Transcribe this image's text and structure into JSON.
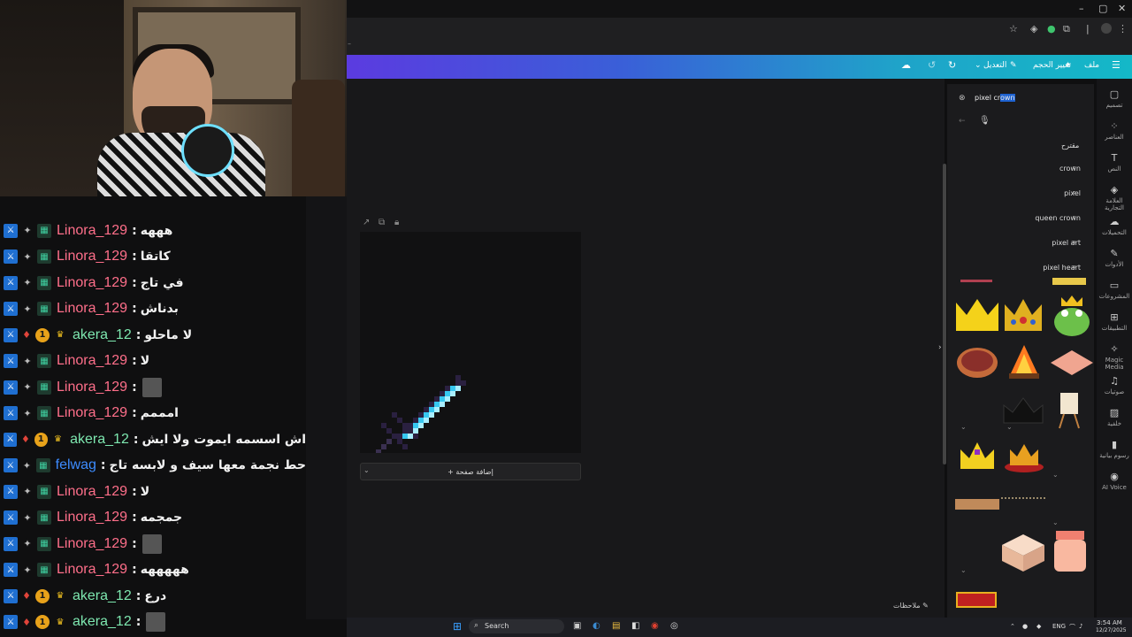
{
  "chat": {
    "messages": [
      {
        "user": "Linora_129",
        "role": "linora",
        "text": "هههه"
      },
      {
        "user": "Linora_129",
        "role": "linora",
        "text": "كاتقا"
      },
      {
        "user": "Linora_129",
        "role": "linora",
        "text": "في تاج"
      },
      {
        "user": "Linora_129",
        "role": "linora",
        "text": "بدناش"
      },
      {
        "user": "akera_12",
        "role": "akera",
        "text": "لا ماحلو"
      },
      {
        "user": "Linora_129",
        "role": "linora",
        "text": "لا"
      },
      {
        "user": "Linora_129",
        "role": "linora",
        "text": ""
      },
      {
        "user": "Linora_129",
        "role": "linora",
        "text": "امممم"
      },
      {
        "user": "akera_12",
        "role": "akera",
        "text": "اش اسسمه ايموت ولا ايش"
      },
      {
        "user": "felwag",
        "role": "felwag",
        "text": "حط نجمة معها سيف و لابسه تاج"
      },
      {
        "user": "Linora_129",
        "role": "linora",
        "text": "لا"
      },
      {
        "user": "Linora_129",
        "role": "linora",
        "text": "جمجمه"
      },
      {
        "user": "Linora_129",
        "role": "linora",
        "text": ""
      },
      {
        "user": "Linora_129",
        "role": "linora",
        "text": "هههههه"
      },
      {
        "user": "akera_12",
        "role": "akera",
        "text": "درع"
      },
      {
        "user": "akera_12",
        "role": "akera",
        "text": ""
      }
    ],
    "separator": ":"
  },
  "toolbar": {
    "file": "ملف",
    "resize": "تغيير الحجم",
    "edit": "التعديل"
  },
  "canvas": {
    "add_page": "+ إضافة صفحة",
    "notes": "ملاحظات"
  },
  "search": {
    "value_prefix": "pixel cr",
    "value_selected": "own",
    "suggested_heading": "مقترح",
    "suggestions": [
      "crown",
      "pixel",
      "queen crown",
      "pixel art",
      "pixel heart"
    ]
  },
  "rail": [
    {
      "icon": "layout-icon",
      "label": "تصميم"
    },
    {
      "icon": "elements-icon",
      "label": "العناصر"
    },
    {
      "icon": "text-icon",
      "label": "النص"
    },
    {
      "icon": "brand-icon",
      "label": "العلامة التجارية"
    },
    {
      "icon": "uploads-icon",
      "label": "التحميلات"
    },
    {
      "icon": "draw-icon",
      "label": "الأدوات"
    },
    {
      "icon": "projects-icon",
      "label": "المشروعات"
    },
    {
      "icon": "apps-icon",
      "label": "التطبيقات"
    },
    {
      "icon": "magic-media-icon",
      "label": "Magic Media"
    },
    {
      "icon": "audio-icon",
      "label": "صوتيات"
    },
    {
      "icon": "background-icon",
      "label": "خلفية"
    },
    {
      "icon": "charts-icon",
      "label": "رسوم بيانية"
    },
    {
      "icon": "ai-voice-icon",
      "label": "AI Voice"
    }
  ],
  "taskbar": {
    "search": "Search",
    "lang": "ENG",
    "time": "3:54 AM",
    "date": "12/27/2025"
  },
  "colors": {
    "linora": "#ff6f8a",
    "akera": "#7ee8b0",
    "felwag": "#3d8cff",
    "toolbar_start": "#5b3be0",
    "toolbar_end": "#14b8c8",
    "sword_blade": "#36c8f0"
  }
}
